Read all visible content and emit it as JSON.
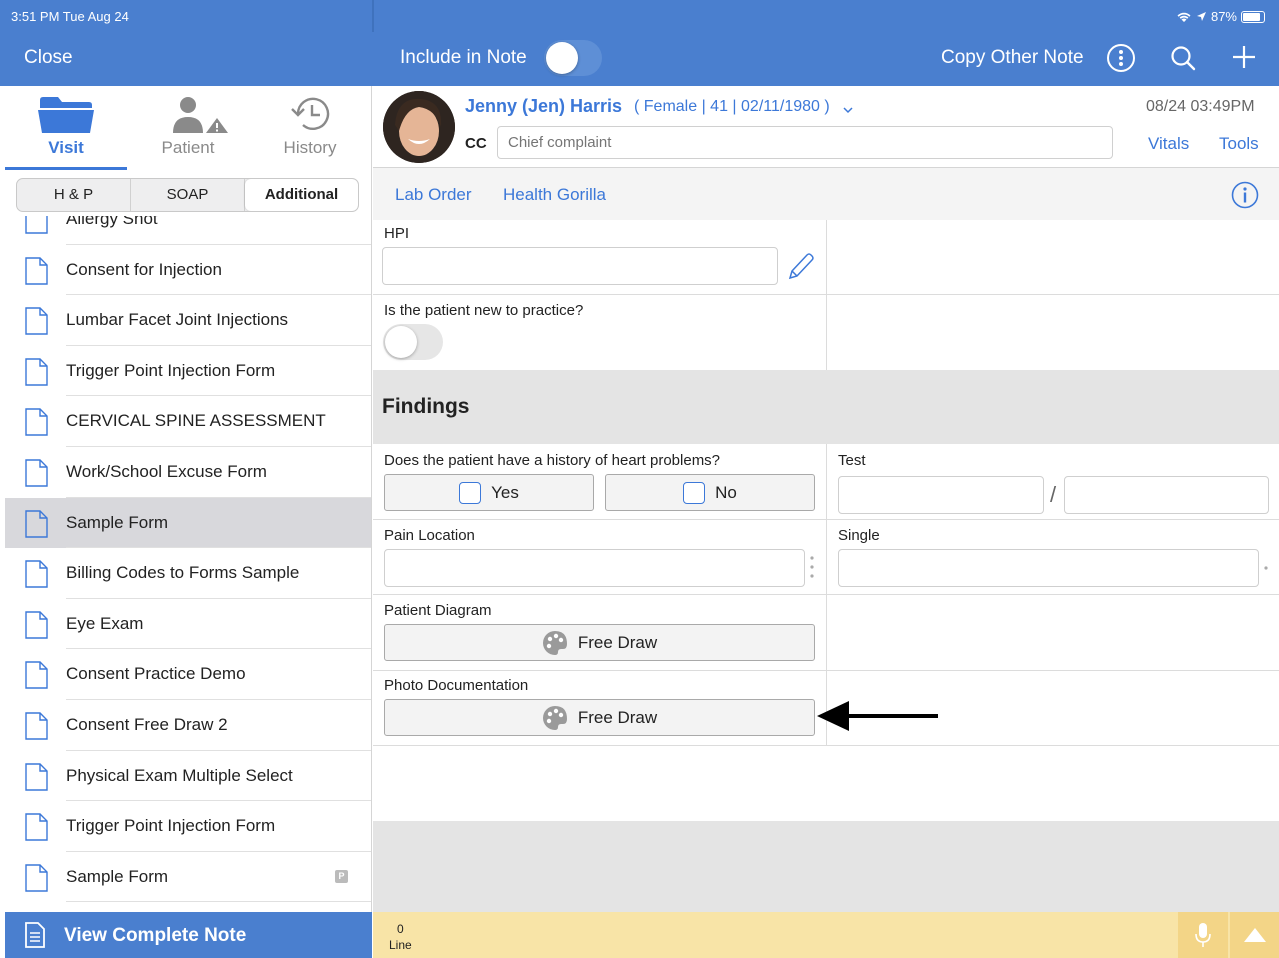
{
  "status_bar": {
    "time": "3:51 PM  Tue Aug 24",
    "battery": "87%"
  },
  "top_bar": {
    "close": "Close",
    "include_in_note": "Include in Note",
    "copy_other_note": "Copy Other Note"
  },
  "left_tabs": [
    {
      "label": "Visit",
      "active": true
    },
    {
      "label": "Patient",
      "active": false
    },
    {
      "label": "History",
      "active": false
    }
  ],
  "segments": [
    "H & P",
    "SOAP",
    "Additional"
  ],
  "forms": [
    {
      "label": "Allergy Shot"
    },
    {
      "label": "Consent for Injection"
    },
    {
      "label": "Lumbar Facet Joint Injections"
    },
    {
      "label": "Trigger Point Injection Form"
    },
    {
      "label": "CERVICAL SPINE ASSESSMENT"
    },
    {
      "label": "Work/School Excuse Form"
    },
    {
      "label": "Sample Form",
      "selected": true
    },
    {
      "label": "Billing Codes to Forms Sample"
    },
    {
      "label": "Eye Exam"
    },
    {
      "label": "Consent Practice Demo"
    },
    {
      "label": "Consent Free Draw 2"
    },
    {
      "label": "Physical Exam Multiple Select"
    },
    {
      "label": "Trigger Point Injection Form"
    },
    {
      "label": "Sample Form",
      "badge": "P"
    }
  ],
  "bottom_left": {
    "label": "View Complete Note"
  },
  "bottom_right": {
    "count": "0",
    "unit": "Line"
  },
  "patient": {
    "name": "Jenny (Jen) Harris",
    "details": "( Female | 41 | 02/11/1980 )",
    "datetime": "08/24 03:49PM",
    "cc_label": "CC",
    "cc_placeholder": "Chief complaint",
    "vitals": "Vitals",
    "tools": "Tools"
  },
  "actions": {
    "lab_order": "Lab Order",
    "health_gorilla": "Health Gorilla"
  },
  "form": {
    "hpi_label": "HPI",
    "new_patient_label": "Is the patient new to practice?",
    "findings_title": "Findings",
    "heart_question": "Does the patient have a history of heart problems?",
    "yes": "Yes",
    "no": "No",
    "test_label": "Test",
    "test_separator": "/",
    "pain_location_label": "Pain Location",
    "single_label": "Single",
    "patient_diagram_label": "Patient Diagram",
    "photo_documentation_label": "Photo Documentation",
    "free_draw": "Free Draw"
  },
  "colors": {
    "brand": "#4a7fcf",
    "link": "#3c78d8",
    "footer": "#f8e4a7"
  }
}
